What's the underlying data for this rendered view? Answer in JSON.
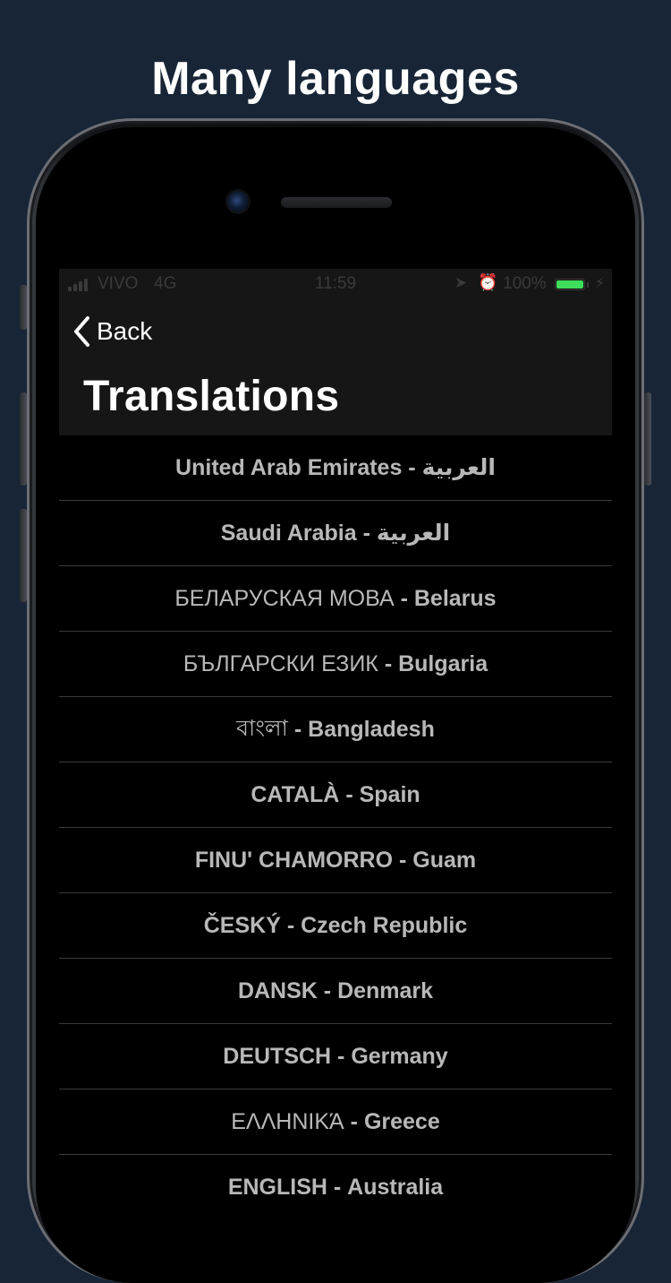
{
  "headline": "Many languages",
  "status_bar": {
    "carrier": "VIVO",
    "network": "4G",
    "time": "11:59",
    "battery_percent": "100%",
    "battery_level": 1.0,
    "battery_color": "#3ddc5a",
    "icons": [
      "signal-icon",
      "location-icon",
      "alarm-icon",
      "battery-icon",
      "charging-icon"
    ]
  },
  "navbar": {
    "back_label": "Back",
    "title": "Translations"
  },
  "translations": [
    {
      "language": "United Arab Emirates",
      "separator": " - ",
      "country": "العربية",
      "language_bold": true
    },
    {
      "language": "Saudi Arabia",
      "separator": " - ",
      "country": "العربية",
      "language_bold": true
    },
    {
      "language": "БЕЛАРУСКАЯ МОВА",
      "separator": " - ",
      "country": "Belarus",
      "language_bold": false
    },
    {
      "language": "БЪЛГАРСКИ ЕЗИК",
      "separator": " - ",
      "country": "Bulgaria",
      "language_bold": false
    },
    {
      "language": "বাংলা",
      "separator": " - ",
      "country": "Bangladesh",
      "language_bold": false
    },
    {
      "language": "CATALÀ",
      "separator": " - ",
      "country": "Spain",
      "language_bold": true
    },
    {
      "language": "FINU' CHAMORRO",
      "separator": " - ",
      "country": "Guam",
      "language_bold": true
    },
    {
      "language": "ČESKÝ",
      "separator": " - ",
      "country": "Czech Republic",
      "language_bold": true
    },
    {
      "language": "DANSK",
      "separator": " - ",
      "country": "Denmark",
      "language_bold": true
    },
    {
      "language": "DEUTSCH",
      "separator": " - ",
      "country": "Germany",
      "language_bold": true
    },
    {
      "language": "ΕΛΛΗΝΙΚΆ",
      "separator": " - ",
      "country": "Greece",
      "language_bold": false
    },
    {
      "language": "ENGLISH",
      "separator": " - ",
      "country": "Australia",
      "language_bold": true
    }
  ]
}
